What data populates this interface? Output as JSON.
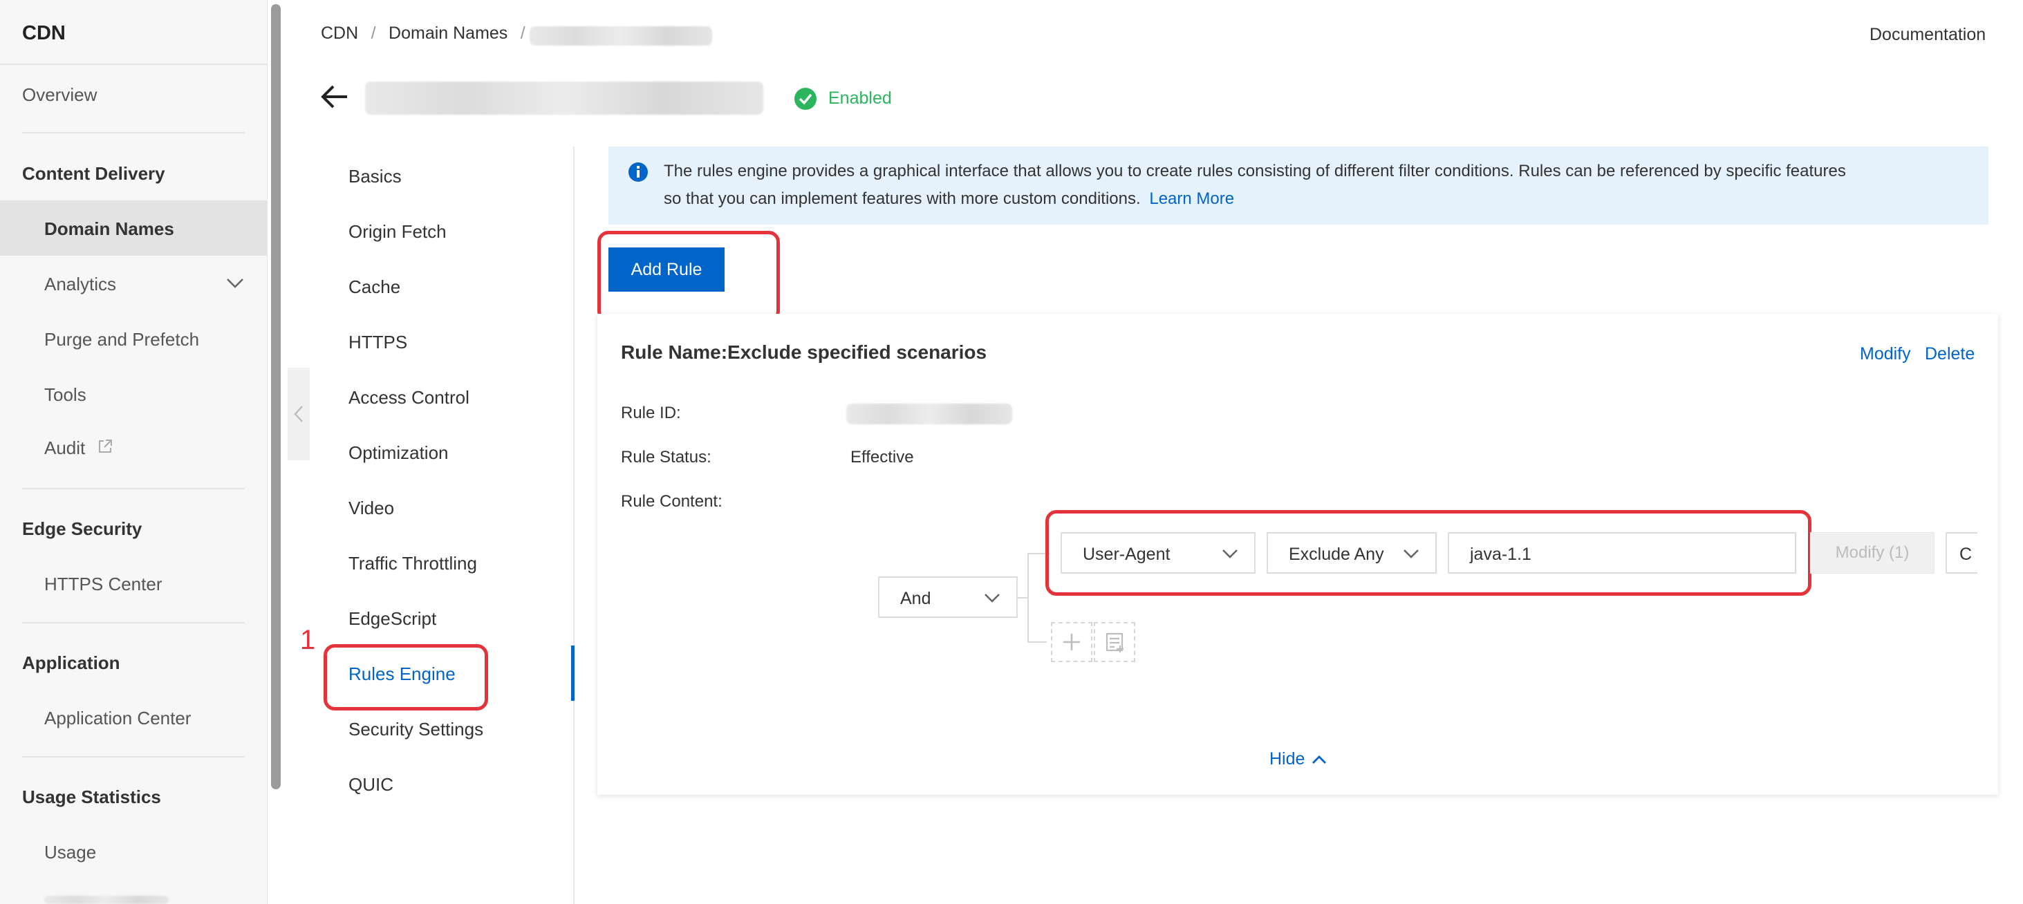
{
  "app": {
    "title": "CDN",
    "documentation": "Documentation"
  },
  "sidebar": {
    "overview": "Overview",
    "sections": [
      {
        "heading": "Content Delivery",
        "items": [
          "Domain Names",
          "Analytics",
          "Purge and Prefetch",
          "Tools",
          "Audit"
        ]
      },
      {
        "heading": "Edge Security",
        "items": [
          "HTTPS Center"
        ]
      },
      {
        "heading": "Application",
        "items": [
          "Application Center"
        ]
      },
      {
        "heading": "Usage Statistics",
        "items": [
          "Usage"
        ]
      }
    ]
  },
  "breadcrumb": {
    "root": "CDN",
    "sep": "/",
    "item": "Domain Names"
  },
  "domain": {
    "status": "Enabled"
  },
  "submenu": [
    "Basics",
    "Origin Fetch",
    "Cache",
    "HTTPS",
    "Access Control",
    "Optimization",
    "Video",
    "Traffic Throttling",
    "EdgeScript",
    "Rules Engine",
    "Security Settings",
    "QUIC"
  ],
  "annotation": {
    "step": "1"
  },
  "banner": {
    "line1": "The rules engine provides a graphical interface that allows you to create rules consisting of different filter conditions. Rules can be referenced by specific features",
    "line2": "so that you can implement features with more custom conditions.",
    "link": "Learn More"
  },
  "add_rule": "Add Rule",
  "rule": {
    "name": "Rule Name:Exclude specified scenarios",
    "modify": "Modify",
    "delete": "Delete",
    "id_label": "Rule ID:",
    "status_label": "Rule Status:",
    "status_value": "Effective",
    "content_label": "Rule Content:",
    "logic": "And",
    "condition": {
      "field": "User-Agent",
      "operator": "Exclude Any",
      "value": "java-1.1",
      "modify_btn": "Modify (1)",
      "next_partial": "C"
    },
    "hide": "Hide"
  },
  "colors": {
    "accent": "#0064c8",
    "success": "#2db55d",
    "highlight": "#e5333b",
    "banner_bg": "#e5f2fc"
  },
  "icons": [
    "back-arrow-icon",
    "check-circle-icon",
    "info-icon",
    "chevron-down-icon",
    "external-link-icon",
    "chevron-left-icon",
    "plus-icon",
    "add-group-icon",
    "chevron-up-icon"
  ]
}
